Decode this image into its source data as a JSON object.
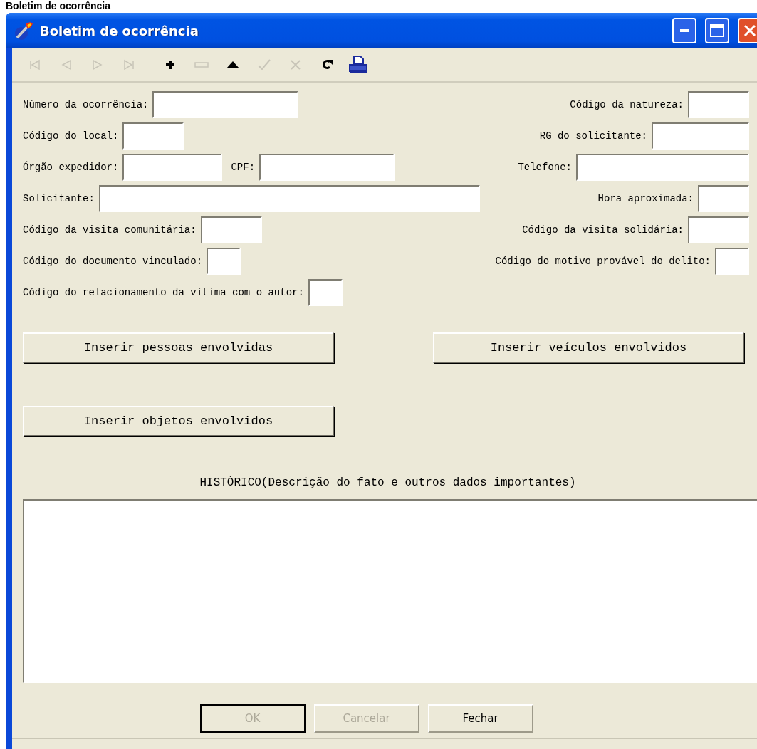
{
  "page_heading": "Boletim de ocorrência",
  "window": {
    "title": "Boletim de ocorrência"
  },
  "toolbar": [
    {
      "kind": "first",
      "enabled": false
    },
    {
      "kind": "prev",
      "enabled": false
    },
    {
      "kind": "next",
      "enabled": false
    },
    {
      "kind": "last",
      "enabled": false
    },
    {
      "kind": "add",
      "enabled": true
    },
    {
      "kind": "remove",
      "enabled": false
    },
    {
      "kind": "up",
      "enabled": true
    },
    {
      "kind": "confirm",
      "enabled": false
    },
    {
      "kind": "cancel",
      "enabled": false
    },
    {
      "kind": "refresh",
      "enabled": true
    },
    {
      "kind": "print",
      "enabled": true
    }
  ],
  "form_rows": [
    [
      {
        "label": "Número da ocorrência:",
        "kind": "long"
      },
      {
        "label": "Código da natureza:",
        "kind": "short"
      }
    ],
    [
      {
        "label": "Código do local:",
        "kind": "short"
      },
      {
        "label": "RG do solicitante:",
        "kind": "rg"
      }
    ],
    [
      {
        "label": "Órgão expedidor:",
        "kind": "medium"
      },
      {
        "label": "CPF:",
        "kind": "cpf"
      },
      {
        "label": "Telefone:",
        "kind": "phone"
      }
    ],
    [
      {
        "label": "Solicitante:",
        "kind": "wide"
      },
      {
        "label": "Hora aproximada:",
        "kind": "hour"
      }
    ],
    [
      {
        "label": "Código da visita comunitária:",
        "kind": "short"
      },
      {
        "label": "Código da visita solidária:",
        "kind": "short"
      }
    ],
    [
      {
        "label": "Código do documento vinculado:",
        "kind": "tiny"
      },
      {
        "label": "Código do motivo provável do delito:",
        "kind": "tiny"
      }
    ],
    [
      {
        "label": "Código do relacionamento da vítima com o autor:",
        "kind": "tiny"
      }
    ]
  ],
  "action_buttons": [
    [
      "Inserir pessoas envolvidas",
      "Inserir veículos envolvidos"
    ],
    [
      "Inserir objetos envolvidos"
    ]
  ],
  "history": {
    "label": "HISTÓRICO(Descrição do fato e outros dados importantes)"
  },
  "footer_buttons": [
    {
      "label": "OK",
      "disabled": true,
      "default": true,
      "mnemonic": false
    },
    {
      "label": "Cancelar",
      "disabled": true,
      "default": false,
      "mnemonic": false
    },
    {
      "label": "Fechar",
      "disabled": false,
      "default": false,
      "mnemonic": true
    }
  ]
}
